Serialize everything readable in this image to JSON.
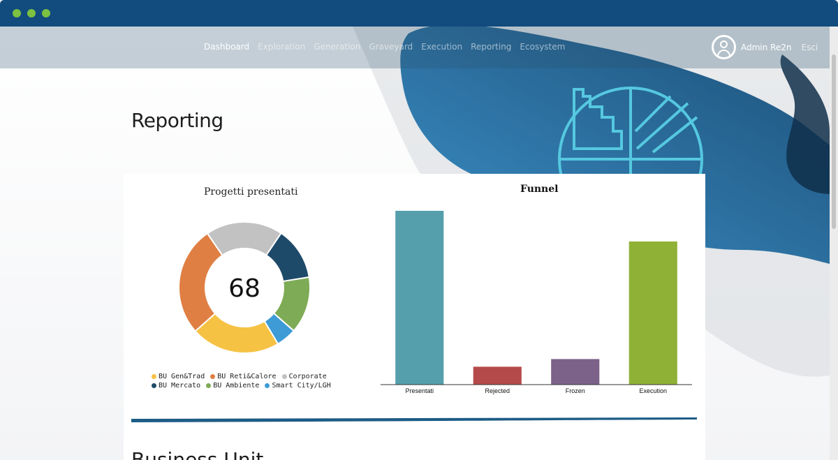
{
  "nav": {
    "items": [
      {
        "label": "Dashboard",
        "active": true
      },
      {
        "label": "Exploration",
        "active": false
      },
      {
        "label": "Generation",
        "active": false
      },
      {
        "label": "Graveyard",
        "active": false
      },
      {
        "label": "Execution",
        "active": false
      },
      {
        "label": "Reporting",
        "active": false
      },
      {
        "label": "Ecosystem",
        "active": false
      }
    ],
    "user_name": "Admin Re2n",
    "logout_label": "Esci"
  },
  "page": {
    "title": "Reporting",
    "section_title": "Business Unit"
  },
  "colors": {
    "window_bar": "#124b7e",
    "traffic_dots": "#7cc142",
    "hero_icon": "#55c8e0"
  },
  "icons": [
    "user-avatar-icon",
    "reporting-chart-icon"
  ],
  "chart_data": [
    {
      "type": "pie",
      "title": "Progetti presentati",
      "center_label": "68",
      "slices": [
        {
          "label": "BU Gen&Trad",
          "value": 0.22,
          "color": "#f6c244"
        },
        {
          "label": "BU Reti&Calore",
          "value": 0.27,
          "color": "#e07f43"
        },
        {
          "label": "Corporate",
          "value": 0.19,
          "color": "#c2c2c2"
        },
        {
          "label": "BU Mercato",
          "value": 0.13,
          "color": "#1e4a69"
        },
        {
          "label": "BU Ambiente",
          "value": 0.14,
          "color": "#7eab55"
        },
        {
          "label": "Smart City/LGH",
          "value": 0.05,
          "color": "#3e9bd6"
        }
      ],
      "slice_order_clockwise_from_top": [
        "Corporate",
        "BU Mercato",
        "BU Ambiente",
        "Smart City/LGH",
        "BU Gen&Trad",
        "BU Reti&Calore"
      ],
      "legend_rows": [
        [
          "BU Gen&Trad",
          "BU Reti&Calore",
          "Corporate"
        ],
        [
          "BU Mercato",
          "BU Ambiente",
          "Smart City/LGH"
        ]
      ]
    },
    {
      "type": "bar",
      "title": "Funnel",
      "categories": [
        "Presentati",
        "Rejected",
        "Frozen",
        "Execution"
      ],
      "values": [
        68,
        7,
        10,
        56
      ],
      "colors": [
        "#559fad",
        "#b54a4a",
        "#7c6288",
        "#8fb236"
      ],
      "ylim": [
        0,
        68
      ],
      "grid": false
    }
  ]
}
